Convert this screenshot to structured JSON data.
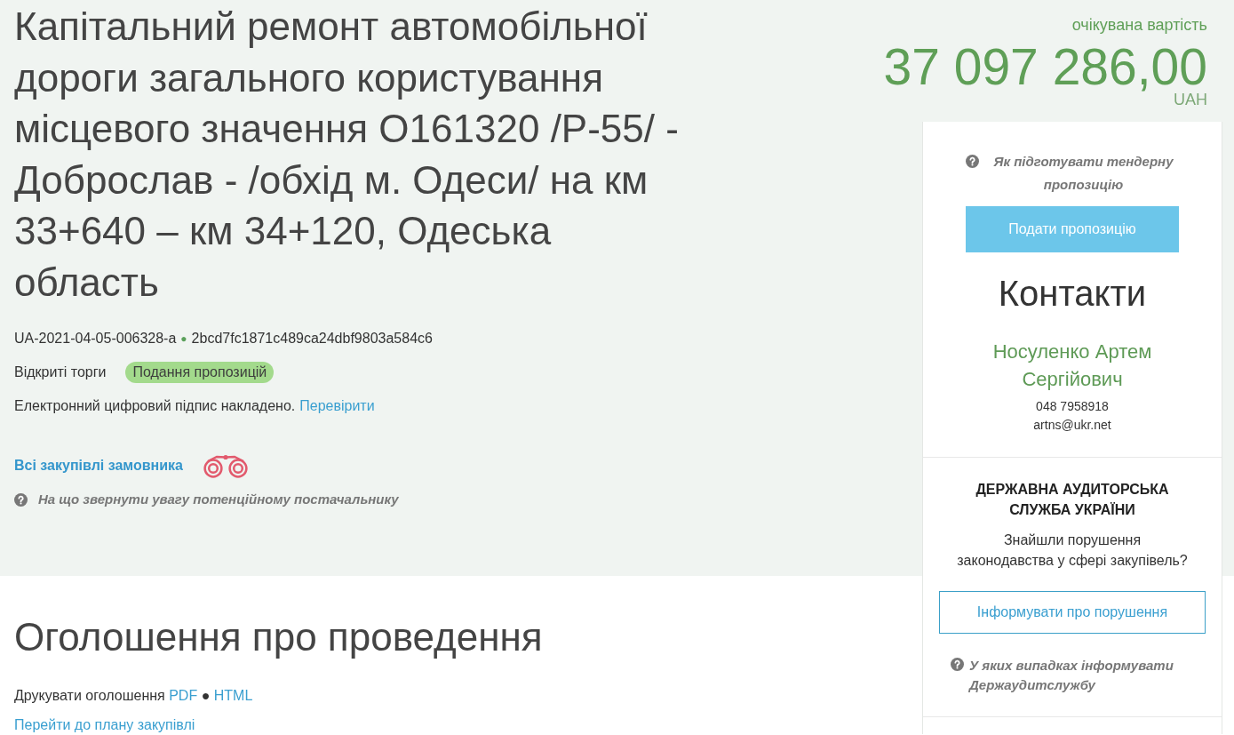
{
  "tender": {
    "title": "Капітальний ремонт автомобільної дороги загального користування місцевого значення О161320 /Р-55/ - Доброслав - /обхід м. Одеси/ на км 33+640 – км 34+120, Одеська область",
    "id": "UA-2021-04-05-006328-a",
    "id_separator": "●",
    "hash": "2bcd7fc1871c489ca24dbf9803a584c6",
    "procedure": "Відкриті торги",
    "status": "Подання пропозицій",
    "signature": {
      "text": "Електронний цифровий підпис накладено.",
      "link": "Перевірити"
    },
    "buyer_link": "Всі закупівлі замовника",
    "hint": "На що звернути увагу потенційному постачальнику"
  },
  "price": {
    "label": "очікувана вартість",
    "amount": "37 097 286,00",
    "currency": "UAH"
  },
  "sidebar": {
    "hint": "Як підготувати тендерну пропозицію",
    "submit_button": "Подати пропозицію",
    "contacts": {
      "title": "Контакти",
      "name": "Носуленко Артем Сергійович",
      "phone": "048 7958918",
      "email": "artns@ukr.net"
    },
    "audit": {
      "title": "ДЕРЖАВНА АУДИТОРСЬКА СЛУЖБА УКРАЇНИ",
      "question": "Знайшли порушення законодавства у сфері закупівель?",
      "report_button": "Інформувати про порушення",
      "hint": "У яких випадках інформувати Держаудитслужбу"
    }
  },
  "announcement": {
    "title": "Оголошення про проведення",
    "print_label": "Друкувати оголошення",
    "print_links": [
      "PDF",
      "HTML"
    ],
    "separator": "●",
    "plan_link": "Перейти до плану закупівлі"
  }
}
